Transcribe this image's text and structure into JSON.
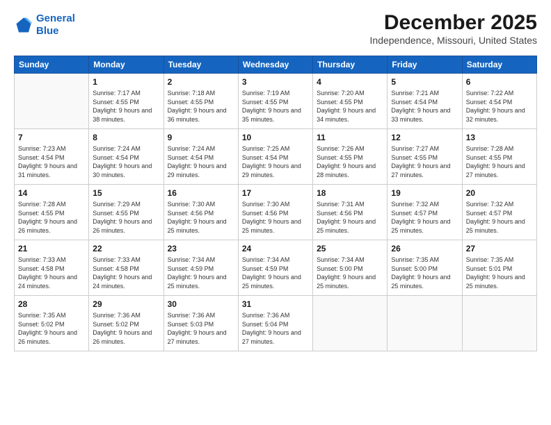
{
  "logo": {
    "line1": "General",
    "line2": "Blue"
  },
  "header": {
    "month": "December 2025",
    "location": "Independence, Missouri, United States"
  },
  "weekdays": [
    "Sunday",
    "Monday",
    "Tuesday",
    "Wednesday",
    "Thursday",
    "Friday",
    "Saturday"
  ],
  "weeks": [
    [
      {
        "day": "",
        "sunrise": "",
        "sunset": "",
        "daylight": ""
      },
      {
        "day": "1",
        "sunrise": "Sunrise: 7:17 AM",
        "sunset": "Sunset: 4:55 PM",
        "daylight": "Daylight: 9 hours and 38 minutes."
      },
      {
        "day": "2",
        "sunrise": "Sunrise: 7:18 AM",
        "sunset": "Sunset: 4:55 PM",
        "daylight": "Daylight: 9 hours and 36 minutes."
      },
      {
        "day": "3",
        "sunrise": "Sunrise: 7:19 AM",
        "sunset": "Sunset: 4:55 PM",
        "daylight": "Daylight: 9 hours and 35 minutes."
      },
      {
        "day": "4",
        "sunrise": "Sunrise: 7:20 AM",
        "sunset": "Sunset: 4:55 PM",
        "daylight": "Daylight: 9 hours and 34 minutes."
      },
      {
        "day": "5",
        "sunrise": "Sunrise: 7:21 AM",
        "sunset": "Sunset: 4:54 PM",
        "daylight": "Daylight: 9 hours and 33 minutes."
      },
      {
        "day": "6",
        "sunrise": "Sunrise: 7:22 AM",
        "sunset": "Sunset: 4:54 PM",
        "daylight": "Daylight: 9 hours and 32 minutes."
      }
    ],
    [
      {
        "day": "7",
        "sunrise": "Sunrise: 7:23 AM",
        "sunset": "Sunset: 4:54 PM",
        "daylight": "Daylight: 9 hours and 31 minutes."
      },
      {
        "day": "8",
        "sunrise": "Sunrise: 7:24 AM",
        "sunset": "Sunset: 4:54 PM",
        "daylight": "Daylight: 9 hours and 30 minutes."
      },
      {
        "day": "9",
        "sunrise": "Sunrise: 7:24 AM",
        "sunset": "Sunset: 4:54 PM",
        "daylight": "Daylight: 9 hours and 29 minutes."
      },
      {
        "day": "10",
        "sunrise": "Sunrise: 7:25 AM",
        "sunset": "Sunset: 4:54 PM",
        "daylight": "Daylight: 9 hours and 29 minutes."
      },
      {
        "day": "11",
        "sunrise": "Sunrise: 7:26 AM",
        "sunset": "Sunset: 4:55 PM",
        "daylight": "Daylight: 9 hours and 28 minutes."
      },
      {
        "day": "12",
        "sunrise": "Sunrise: 7:27 AM",
        "sunset": "Sunset: 4:55 PM",
        "daylight": "Daylight: 9 hours and 27 minutes."
      },
      {
        "day": "13",
        "sunrise": "Sunrise: 7:28 AM",
        "sunset": "Sunset: 4:55 PM",
        "daylight": "Daylight: 9 hours and 27 minutes."
      }
    ],
    [
      {
        "day": "14",
        "sunrise": "Sunrise: 7:28 AM",
        "sunset": "Sunset: 4:55 PM",
        "daylight": "Daylight: 9 hours and 26 minutes."
      },
      {
        "day": "15",
        "sunrise": "Sunrise: 7:29 AM",
        "sunset": "Sunset: 4:55 PM",
        "daylight": "Daylight: 9 hours and 26 minutes."
      },
      {
        "day": "16",
        "sunrise": "Sunrise: 7:30 AM",
        "sunset": "Sunset: 4:56 PM",
        "daylight": "Daylight: 9 hours and 25 minutes."
      },
      {
        "day": "17",
        "sunrise": "Sunrise: 7:30 AM",
        "sunset": "Sunset: 4:56 PM",
        "daylight": "Daylight: 9 hours and 25 minutes."
      },
      {
        "day": "18",
        "sunrise": "Sunrise: 7:31 AM",
        "sunset": "Sunset: 4:56 PM",
        "daylight": "Daylight: 9 hours and 25 minutes."
      },
      {
        "day": "19",
        "sunrise": "Sunrise: 7:32 AM",
        "sunset": "Sunset: 4:57 PM",
        "daylight": "Daylight: 9 hours and 25 minutes."
      },
      {
        "day": "20",
        "sunrise": "Sunrise: 7:32 AM",
        "sunset": "Sunset: 4:57 PM",
        "daylight": "Daylight: 9 hours and 25 minutes."
      }
    ],
    [
      {
        "day": "21",
        "sunrise": "Sunrise: 7:33 AM",
        "sunset": "Sunset: 4:58 PM",
        "daylight": "Daylight: 9 hours and 24 minutes."
      },
      {
        "day": "22",
        "sunrise": "Sunrise: 7:33 AM",
        "sunset": "Sunset: 4:58 PM",
        "daylight": "Daylight: 9 hours and 24 minutes."
      },
      {
        "day": "23",
        "sunrise": "Sunrise: 7:34 AM",
        "sunset": "Sunset: 4:59 PM",
        "daylight": "Daylight: 9 hours and 25 minutes."
      },
      {
        "day": "24",
        "sunrise": "Sunrise: 7:34 AM",
        "sunset": "Sunset: 4:59 PM",
        "daylight": "Daylight: 9 hours and 25 minutes."
      },
      {
        "day": "25",
        "sunrise": "Sunrise: 7:34 AM",
        "sunset": "Sunset: 5:00 PM",
        "daylight": "Daylight: 9 hours and 25 minutes."
      },
      {
        "day": "26",
        "sunrise": "Sunrise: 7:35 AM",
        "sunset": "Sunset: 5:00 PM",
        "daylight": "Daylight: 9 hours and 25 minutes."
      },
      {
        "day": "27",
        "sunrise": "Sunrise: 7:35 AM",
        "sunset": "Sunset: 5:01 PM",
        "daylight": "Daylight: 9 hours and 25 minutes."
      }
    ],
    [
      {
        "day": "28",
        "sunrise": "Sunrise: 7:35 AM",
        "sunset": "Sunset: 5:02 PM",
        "daylight": "Daylight: 9 hours and 26 minutes."
      },
      {
        "day": "29",
        "sunrise": "Sunrise: 7:36 AM",
        "sunset": "Sunset: 5:02 PM",
        "daylight": "Daylight: 9 hours and 26 minutes."
      },
      {
        "day": "30",
        "sunrise": "Sunrise: 7:36 AM",
        "sunset": "Sunset: 5:03 PM",
        "daylight": "Daylight: 9 hours and 27 minutes."
      },
      {
        "day": "31",
        "sunrise": "Sunrise: 7:36 AM",
        "sunset": "Sunset: 5:04 PM",
        "daylight": "Daylight: 9 hours and 27 minutes."
      },
      {
        "day": "",
        "sunrise": "",
        "sunset": "",
        "daylight": ""
      },
      {
        "day": "",
        "sunrise": "",
        "sunset": "",
        "daylight": ""
      },
      {
        "day": "",
        "sunrise": "",
        "sunset": "",
        "daylight": ""
      }
    ]
  ]
}
